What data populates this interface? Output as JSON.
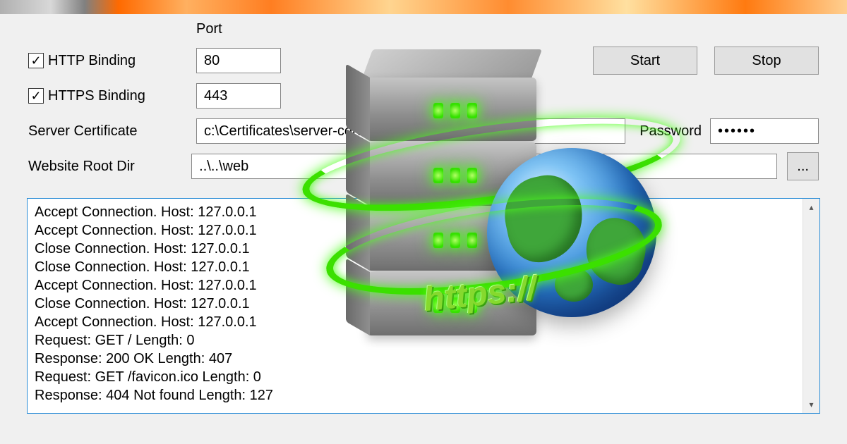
{
  "labels": {
    "port_header": "Port",
    "http_binding": "HTTP Binding",
    "https_binding": "HTTPS Binding",
    "server_certificate": "Server Certificate",
    "website_root_dir": "Website Root Dir",
    "password": "Password"
  },
  "values": {
    "http_port": "80",
    "https_port": "443",
    "cert_path": "c:\\Certificates\\server-certificat",
    "root_dir": "..\\..\\web",
    "password_masked": "••••••"
  },
  "buttons": {
    "start": "Start",
    "stop": "Stop",
    "browse": "..."
  },
  "checks": {
    "http": "✓",
    "https": "✓"
  },
  "artwork": {
    "https_label": "https://"
  },
  "log": [
    "Accept Connection. Host: 127.0.0.1",
    "Accept Connection. Host: 127.0.0.1",
    "Close Connection. Host: 127.0.0.1",
    "Close Connection. Host: 127.0.0.1",
    "Accept Connection. Host: 127.0.0.1",
    "Close Connection. Host: 127.0.0.1",
    "Accept Connection. Host: 127.0.0.1",
    "Request: GET / Length: 0",
    "Response: 200 OK Length: 407",
    "Request: GET /favicon.ico Length: 0",
    "Response: 404 Not found Length: 127"
  ]
}
